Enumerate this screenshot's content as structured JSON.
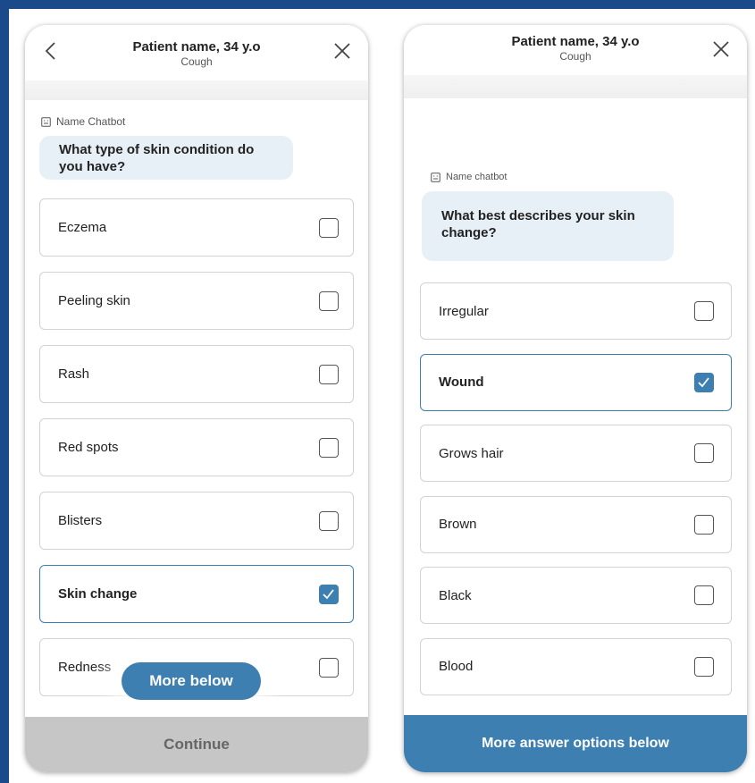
{
  "colors": {
    "frame": "#1a4a8a",
    "accent": "#3d7fb0",
    "bubble": "#e8f0f7",
    "disabled": "#c6c6c6"
  },
  "left": {
    "header": {
      "title": "Patient name, 34 y.o",
      "subtitle": "Cough"
    },
    "bot_name": "Name Chatbot",
    "question": "What type of skin condition do you have?",
    "options": [
      {
        "label": "Eczema",
        "checked": false
      },
      {
        "label": "Peeling skin",
        "checked": false
      },
      {
        "label": "Rash",
        "checked": false
      },
      {
        "label": "Red spots",
        "checked": false
      },
      {
        "label": "Blisters",
        "checked": false
      },
      {
        "label": "Skin change",
        "checked": true
      },
      {
        "label": "Redness",
        "checked": false
      }
    ],
    "more_below_label": "More below",
    "continue_label": "Continue"
  },
  "right": {
    "header": {
      "title": "Patient name, 34 y.o",
      "subtitle": "Cough"
    },
    "bot_name": "Name chatbot",
    "question": "What best describes your skin change?",
    "options": [
      {
        "label": "Irregular",
        "checked": false
      },
      {
        "label": "Wound",
        "checked": true
      },
      {
        "label": "Grows hair",
        "checked": false
      },
      {
        "label": "Brown",
        "checked": false
      },
      {
        "label": "Black",
        "checked": false
      },
      {
        "label": "Blood",
        "checked": false
      }
    ],
    "more_options_label": "More answer options below"
  },
  "icons": {
    "back": "chevron-left-icon",
    "close": "close-icon",
    "bot": "chatbot-icon",
    "check": "checkmark-icon"
  }
}
